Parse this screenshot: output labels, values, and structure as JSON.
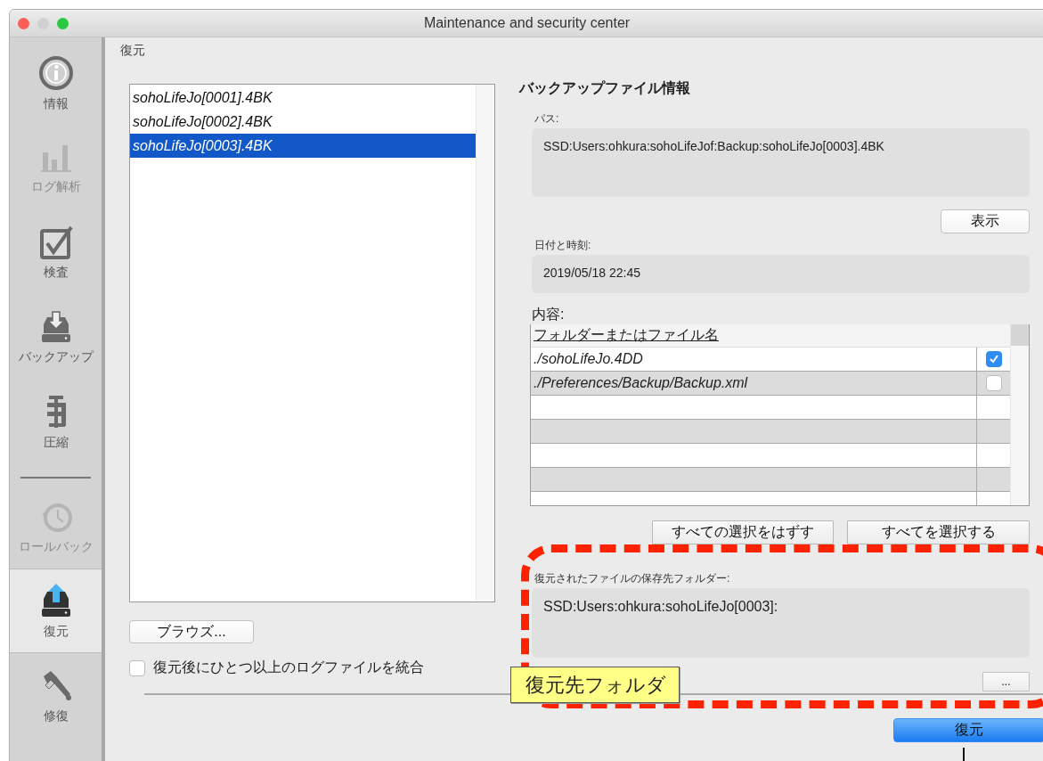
{
  "window": {
    "title": "Maintenance and security center"
  },
  "sidebar": {
    "items": [
      {
        "kind": "info",
        "label": "情報",
        "selected": false,
        "disabled": false
      },
      {
        "kind": "log",
        "label": "ログ解析",
        "selected": false,
        "disabled": true
      },
      {
        "kind": "verify",
        "label": "検査",
        "selected": false,
        "disabled": false
      },
      {
        "kind": "backup",
        "label": "バックアップ",
        "selected": false,
        "disabled": false
      },
      {
        "kind": "compact",
        "label": "圧縮",
        "selected": false,
        "disabled": false
      },
      {
        "kind": "separator"
      },
      {
        "kind": "rollback",
        "label": "ロールバック",
        "selected": false,
        "disabled": true
      },
      {
        "kind": "restore",
        "label": "復元",
        "selected": true,
        "disabled": false
      },
      {
        "kind": "repair",
        "label": "修復",
        "selected": false,
        "disabled": false
      }
    ]
  },
  "page": {
    "title": "復元"
  },
  "backup_list": {
    "items": [
      {
        "name": "sohoLifeJo[0001].4BK",
        "selected": false
      },
      {
        "name": "sohoLifeJo[0002].4BK",
        "selected": false
      },
      {
        "name": "sohoLifeJo[0003].4BK",
        "selected": true
      }
    ]
  },
  "browse_button": "ブラウズ...",
  "merge_logs": {
    "label": "復元後にひとつ以上のログファイルを統合",
    "checked": false
  },
  "info": {
    "title": "バックアップファイル情報",
    "path_label": "パス:",
    "path": "SSD:Users:ohkura:sohoLifeJof:Backup:sohoLifeJo[0003].4BK",
    "show_button": "表示",
    "date_label": "日付と時刻:",
    "date": "2019/05/18 22:45",
    "contents_label": "内容:",
    "table": {
      "columns": [
        "フォルダーまたはファイル名"
      ],
      "rows": [
        {
          "name": "./sohoLifeJo.4DD",
          "checked": true
        },
        {
          "name": "./Preferences/Backup/Backup.xml",
          "checked": false
        }
      ]
    },
    "deselect_all_button": "すべての選択をはずす",
    "select_all_button": "すべてを選択する",
    "dest_label": "復元されたファイルの保存先フォルダー:",
    "dest": "SSD:Users:ohkura:sohoLifeJo[0003]:",
    "dest_browse_button": "..."
  },
  "annotation": {
    "label": "復元先フォルダ"
  },
  "restore_button": "復元"
}
